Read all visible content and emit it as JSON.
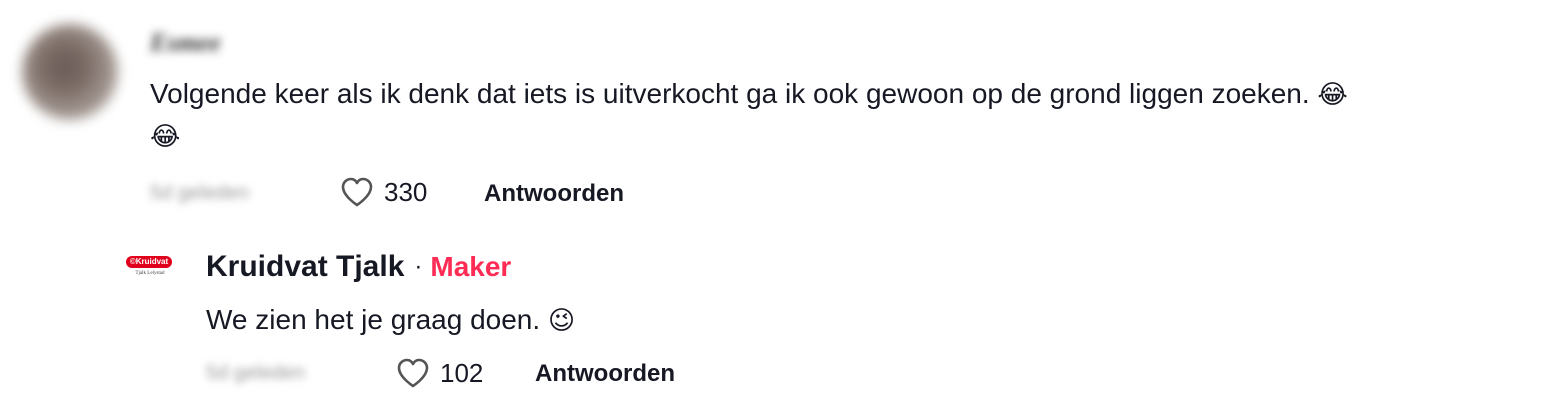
{
  "comments": [
    {
      "username": "Esmee",
      "text": "Volgende keer als ik denk dat iets is uitverkocht ga ik ook gewoon op de grond liggen zoeken.",
      "emoji_inline": "😂",
      "emoji_wrap": "😂",
      "time": "5d geleden",
      "likes": "330",
      "reply_label": "Antwoorden"
    }
  ],
  "reply": {
    "logo_text": "©Kruidvat",
    "logo_sub": "Tjalk Lelystad",
    "username": "Kruidvat Tjalk",
    "separator": "·",
    "badge": "Maker",
    "text": "We zien het je graag doen.",
    "emoji": "😉",
    "time": "5d geleden",
    "likes": "102",
    "reply_label": "Antwoorden"
  },
  "colors": {
    "accent": "#fe2c55",
    "brand_red": "#e0001b",
    "text": "#161823"
  },
  "icons": {
    "like": "heart-outline-icon"
  }
}
